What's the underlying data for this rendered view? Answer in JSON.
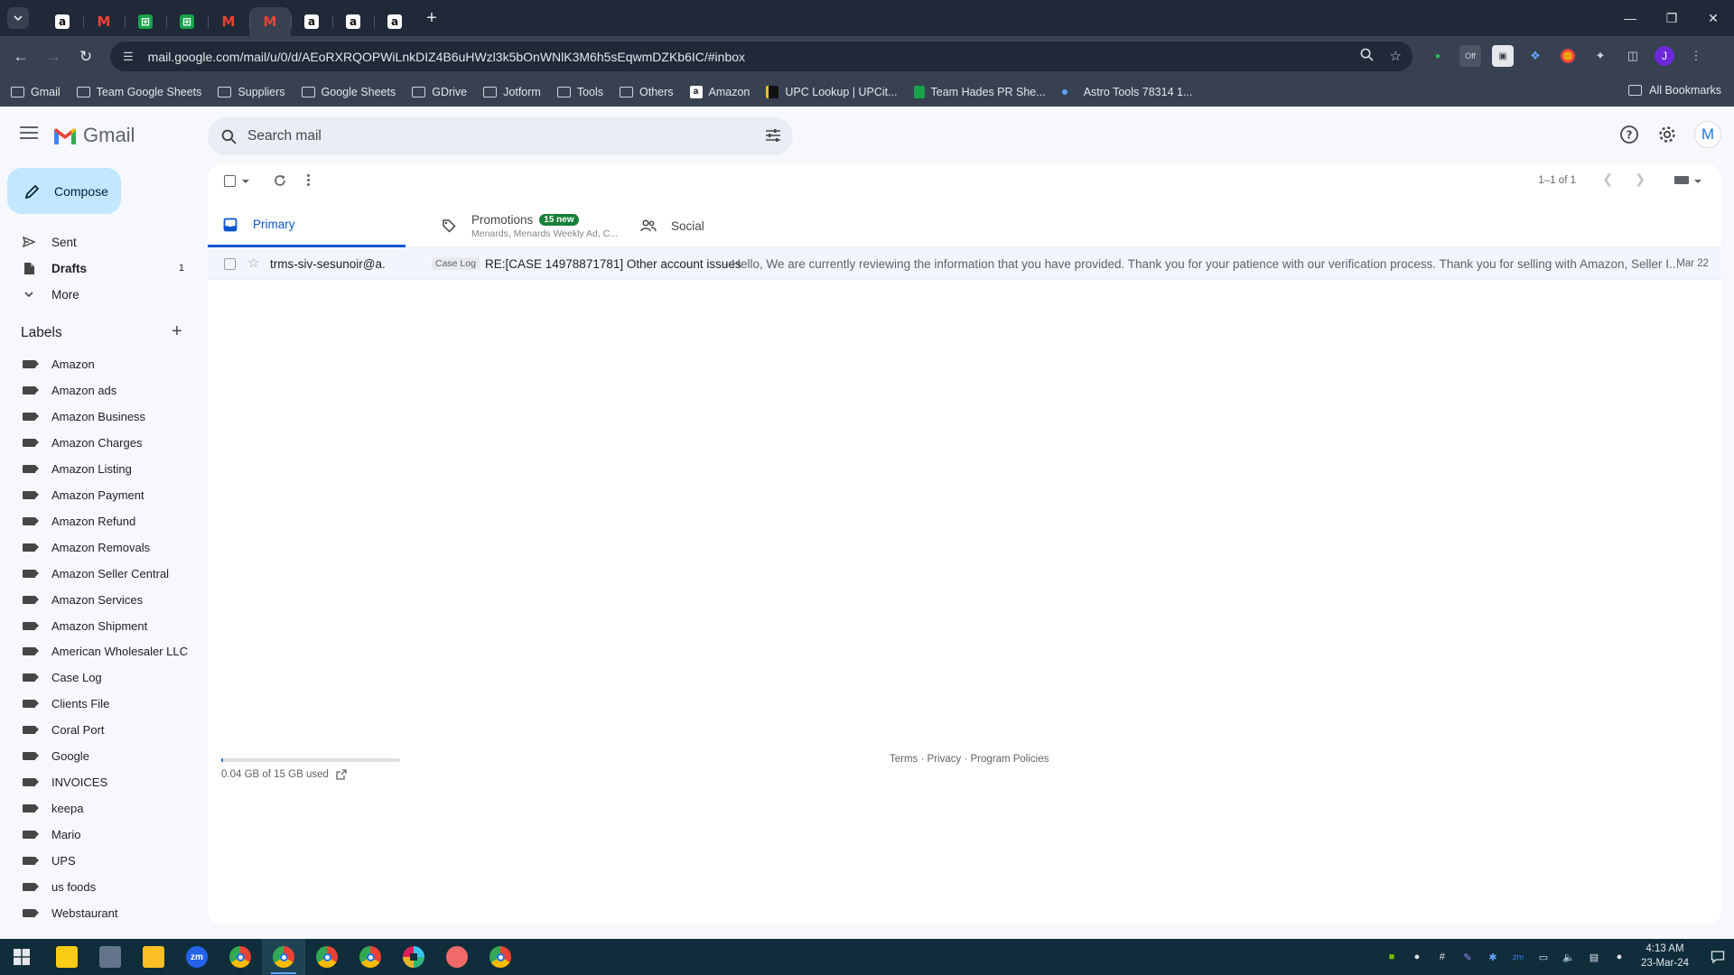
{
  "browser": {
    "tabs": [
      {
        "icon": "amazon-favicon",
        "active": false
      },
      {
        "icon": "gmail-favicon",
        "active": false
      },
      {
        "icon": "sheets-favicon",
        "active": false
      },
      {
        "icon": "sheets-favicon",
        "active": false
      },
      {
        "icon": "gmail-favicon",
        "active": false
      },
      {
        "icon": "gmail-favicon",
        "active": true
      },
      {
        "icon": "amazon-favicon",
        "active": false
      },
      {
        "icon": "amazon-favicon",
        "active": false
      },
      {
        "icon": "amazon-favicon",
        "active": false
      }
    ],
    "url": "mail.google.com/mail/u/0/d/AEoRXRQOPWiLnkDIZ4B6uHWzl3k5bOnWNlK3M6h5sEqwmDZKb6IC/#inbox",
    "profile_initial": "J",
    "bookmarks": [
      {
        "label": "Gmail",
        "icon": "folder"
      },
      {
        "label": "Team Google Sheets",
        "icon": "folder"
      },
      {
        "label": "Suppliers",
        "icon": "folder"
      },
      {
        "label": "Google Sheets",
        "icon": "folder"
      },
      {
        "label": "GDrive",
        "icon": "folder"
      },
      {
        "label": "Jotform",
        "icon": "folder"
      },
      {
        "label": "Tools",
        "icon": "folder"
      },
      {
        "label": "Others",
        "icon": "folder"
      },
      {
        "label": "Amazon",
        "icon": "amazon"
      },
      {
        "label": "UPC Lookup | UPCit...",
        "icon": "upc"
      },
      {
        "label": "Team Hades PR She...",
        "icon": "sheet"
      },
      {
        "label": "Astro Tools 78314 1...",
        "icon": "dot"
      }
    ],
    "all_bookmarks": "All Bookmarks"
  },
  "gmail": {
    "logo_text": "Gmail",
    "search_placeholder": "Search mail",
    "account_initial": "M",
    "compose_label": "Compose",
    "nav": [
      {
        "label": "Sent",
        "icon": "send-icon",
        "count": "",
        "bold": false
      },
      {
        "label": "Drafts",
        "icon": "draft-icon",
        "count": "1",
        "bold": true
      },
      {
        "label": "More",
        "icon": "chevron-down-icon",
        "count": "",
        "bold": false
      }
    ],
    "labels_title": "Labels",
    "labels": [
      "Amazon",
      "Amazon ads",
      "Amazon Business",
      "Amazon Charges",
      "Amazon Listing",
      "Amazon Payment",
      "Amazon Refund",
      "Amazon Removals",
      "Amazon Seller Central",
      "Amazon Services",
      "Amazon Shipment",
      "American Wholesaler LLC",
      "Case Log",
      "Clients File",
      "Coral Port",
      "Google",
      "INVOICES",
      "keepa",
      "Mario",
      "UPS",
      "us foods",
      "Webstaurant"
    ],
    "pager": "1–1 of 1",
    "tabs": {
      "primary": "Primary",
      "promotions": "Promotions",
      "promotions_badge": "15 new",
      "promotions_sub": "Menards, Menards Weekly Ad, C...",
      "social": "Social"
    },
    "emails": [
      {
        "sender": "trms-siv-sesunoir@a.",
        "label": "Case Log",
        "subject": "RE:[CASE 14978871781] Other account issues",
        "snippet": "- Hello, We are currently reviewing the information that you have provided. Thank you for your patience with our verification process. Thank you for selling with Amazon, Seller I...",
        "date": "Mar 22"
      }
    ],
    "storage_text": "0.04 GB of 15 GB used",
    "storage_fraction": 0.003,
    "footer": "Terms · Privacy · Program Policies"
  },
  "taskbar": {
    "apps": [
      "sticky-notes",
      "calculator",
      "file-explorer",
      "zoom",
      "chrome",
      "chrome",
      "chrome",
      "chrome",
      "slack",
      "asana",
      "chrome"
    ],
    "active_index": 5,
    "zoom_label": "zm",
    "time": "4:13 AM",
    "date": "23-Mar-24"
  }
}
